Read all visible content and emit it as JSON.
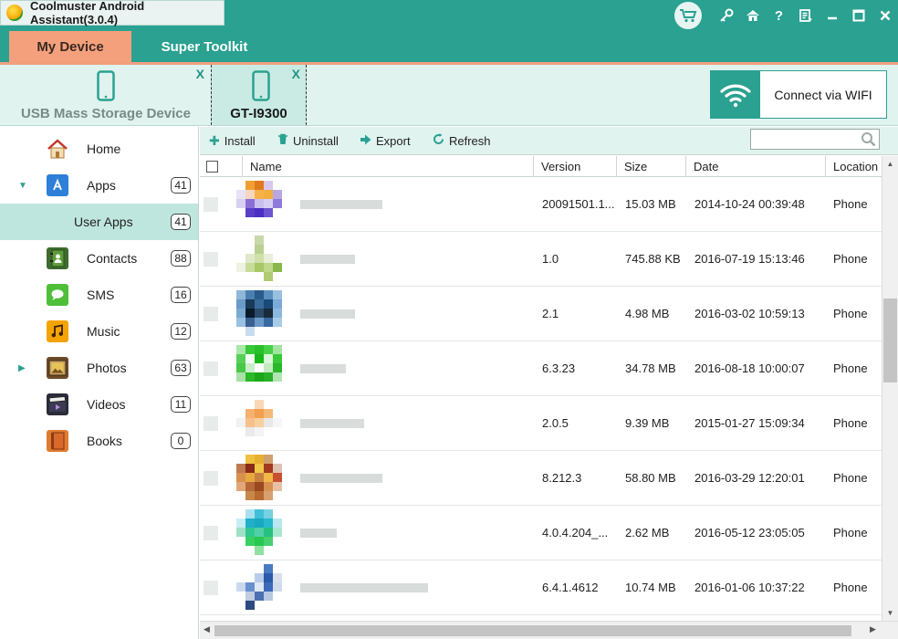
{
  "window": {
    "title": "Coolmuster Android Assistant(3.0.4)",
    "controls": [
      "cart-icon",
      "key-icon",
      "home-icon",
      "help-icon",
      "feedback-icon",
      "minimize-icon",
      "maximize-icon",
      "close-icon"
    ]
  },
  "tabs": [
    {
      "label": "My Device",
      "active": true
    },
    {
      "label": "Super Toolkit",
      "active": false
    }
  ],
  "devices": [
    {
      "label": "USB Mass Storage Device",
      "close": "X",
      "active": false
    },
    {
      "label": "GT-I9300",
      "close": "X",
      "active": true
    }
  ],
  "wifi_button": {
    "label": "Connect via WIFI",
    "icon": "wifi-icon"
  },
  "sidebar": {
    "items": [
      {
        "label": "Home",
        "count": "",
        "icon": "home-icon"
      },
      {
        "label": "Apps",
        "count": "41",
        "icon": "apps-icon",
        "expanded": true
      },
      {
        "label": "User Apps",
        "count": "41",
        "sub": true,
        "active": true
      },
      {
        "label": "Contacts",
        "count": "88",
        "icon": "contacts-icon"
      },
      {
        "label": "SMS",
        "count": "16",
        "icon": "sms-icon"
      },
      {
        "label": "Music",
        "count": "12",
        "icon": "music-icon"
      },
      {
        "label": "Photos",
        "count": "63",
        "icon": "photos-icon",
        "expandable": true
      },
      {
        "label": "Videos",
        "count": "11",
        "icon": "videos-icon"
      },
      {
        "label": "Books",
        "count": "0",
        "icon": "books-icon"
      }
    ]
  },
  "toolbar": {
    "install": "Install",
    "uninstall": "Uninstall",
    "export": "Export",
    "refresh": "Refresh",
    "search_value": ""
  },
  "table": {
    "columns": [
      "Name",
      "Version",
      "Size",
      "Date",
      "Location"
    ],
    "rows": [
      {
        "version": "20091501.1...",
        "size": "15.03 MB",
        "date": "2014-10-24 00:39:48",
        "location": "Phone"
      },
      {
        "version": "1.0",
        "size": "745.88 KB",
        "date": "2016-07-19 15:13:46",
        "location": "Phone"
      },
      {
        "version": "2.1",
        "size": "4.98 MB",
        "date": "2016-03-02 10:59:13",
        "location": "Phone"
      },
      {
        "version": "6.3.23",
        "size": "34.78 MB",
        "date": "2016-08-18 10:00:07",
        "location": "Phone"
      },
      {
        "version": "2.0.5",
        "size": "9.39 MB",
        "date": "2015-01-27 15:09:34",
        "location": "Phone"
      },
      {
        "version": "8.212.3",
        "size": "58.80 MB",
        "date": "2016-03-29 12:20:01",
        "location": "Phone"
      },
      {
        "version": "4.0.4.204_...",
        "size": "2.62 MB",
        "date": "2016-05-12 23:05:05",
        "location": "Phone"
      },
      {
        "version": "6.4.1.4612",
        "size": "10.74 MB",
        "date": "2016-01-06 10:37:22",
        "location": "Phone"
      }
    ]
  },
  "colors": {
    "accent": "#2aa191",
    "tab_active": "#f4a07c",
    "device_bar": "#e0f3ef",
    "sidebar_active": "#bfe6de"
  }
}
